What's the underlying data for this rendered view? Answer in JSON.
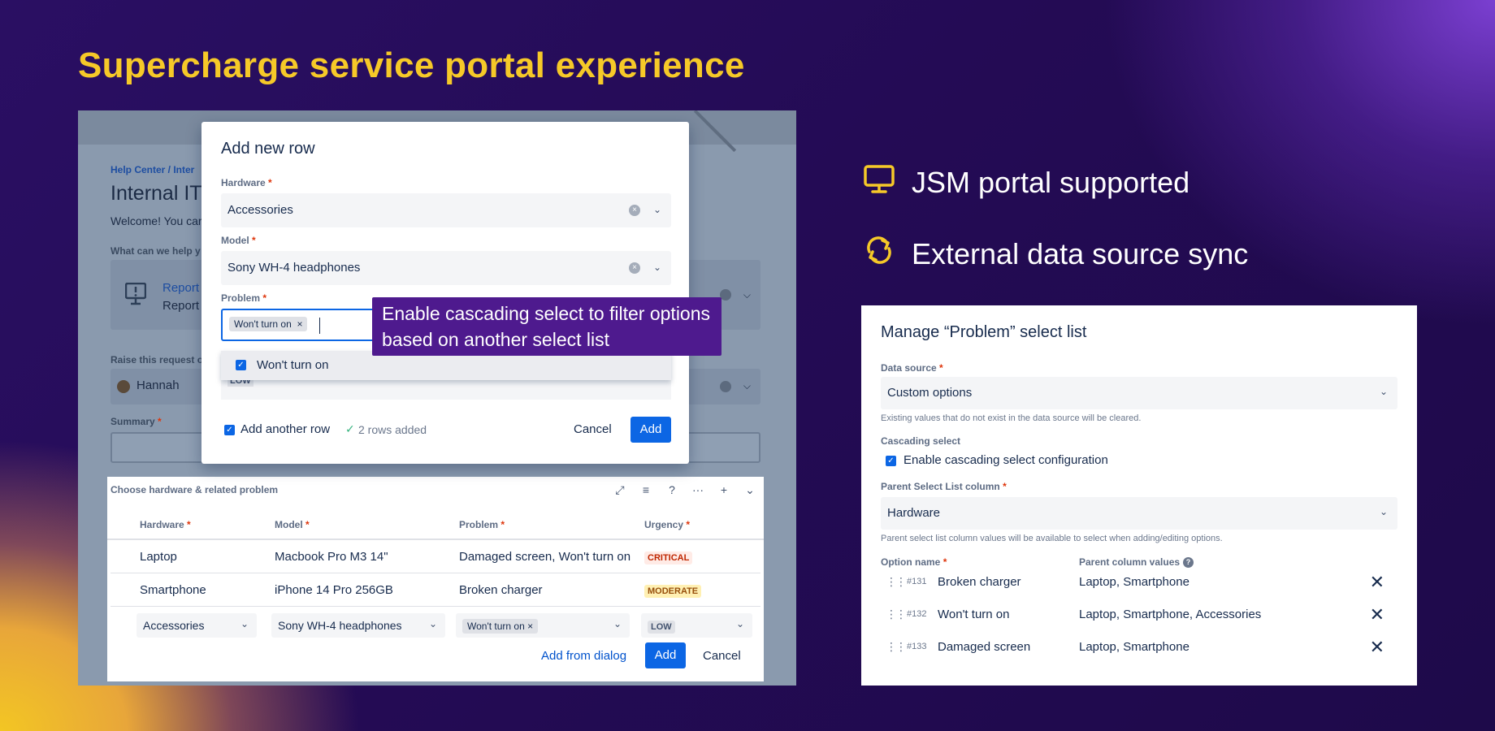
{
  "headline": "Supercharge service portal experience",
  "features": [
    {
      "label": "JSM portal supported",
      "icon": "monitor-icon"
    },
    {
      "label": "External data source sync",
      "icon": "sync-icon"
    }
  ],
  "colors": {
    "accent_yellow": "#f6c928",
    "primary_blue": "#0c66e4",
    "tooltip_purple": "#4e1a8e"
  },
  "portal": {
    "breadcrumb": "Help Center  /  Inter",
    "title": "Internal IT",
    "welcome": "Welcome! You car",
    "help_question": "What can we help y",
    "request_type_title": "Report",
    "request_type_desc": "Report",
    "raise_label": "Raise this request o",
    "raise_value": "Hannah",
    "summary_label": "Summary"
  },
  "table": {
    "caption": "Choose hardware & related problem",
    "columns": [
      "Hardware",
      "Model",
      "Problem",
      "Urgency"
    ],
    "rows": [
      {
        "hardware": "Laptop",
        "model": "Macbook Pro M3 14\"",
        "problem": "Damaged screen, Won't turn on",
        "urgency": "CRITICAL"
      },
      {
        "hardware": "Smartphone",
        "model": "iPhone 14 Pro 256GB",
        "problem": "Broken charger",
        "urgency": "MODERATE"
      }
    ],
    "edit_row": {
      "hardware": "Accessories",
      "model": "Sony WH-4 headphones",
      "problem_tag": "Won't turn on",
      "urgency": "LOW"
    },
    "add_from_dialog": "Add from dialog",
    "add": "Add",
    "cancel": "Cancel"
  },
  "modal": {
    "title": "Add new row",
    "hardware_label": "Hardware",
    "hardware_value": "Accessories",
    "model_label": "Model",
    "model_value": "Sony WH-4 headphones",
    "problem_label": "Problem",
    "problem_tag": "Won't turn on",
    "option": "Won't turn on",
    "ghost_value": "LOW",
    "add_another": "Add another row",
    "rows_added": "2 rows added",
    "cancel": "Cancel",
    "add": "Add"
  },
  "tooltip": {
    "line1": "Enable cascading select to filter options",
    "line2": "based on another select list"
  },
  "manage": {
    "title": "Manage “Problem” select list",
    "data_source_label": "Data source",
    "data_source_value": "Custom options",
    "data_source_help": "Existing values that do not exist in the data source will be cleared.",
    "cascading_label": "Cascading select",
    "cascading_checkbox": "Enable cascading select configuration",
    "parent_label": "Parent Select List column",
    "parent_value": "Hardware",
    "parent_help": "Parent select list column values will be available to select when adding/editing options.",
    "option_name_header": "Option name",
    "parent_values_header": "Parent column values",
    "options": [
      {
        "id": "#131",
        "name": "Broken charger",
        "parents": "Laptop, Smartphone"
      },
      {
        "id": "#132",
        "name": "Won't turn on",
        "parents": "Laptop, Smartphone, Accessories"
      },
      {
        "id": "#133",
        "name": "Damaged screen",
        "parents": "Laptop, Smartphone"
      }
    ]
  }
}
